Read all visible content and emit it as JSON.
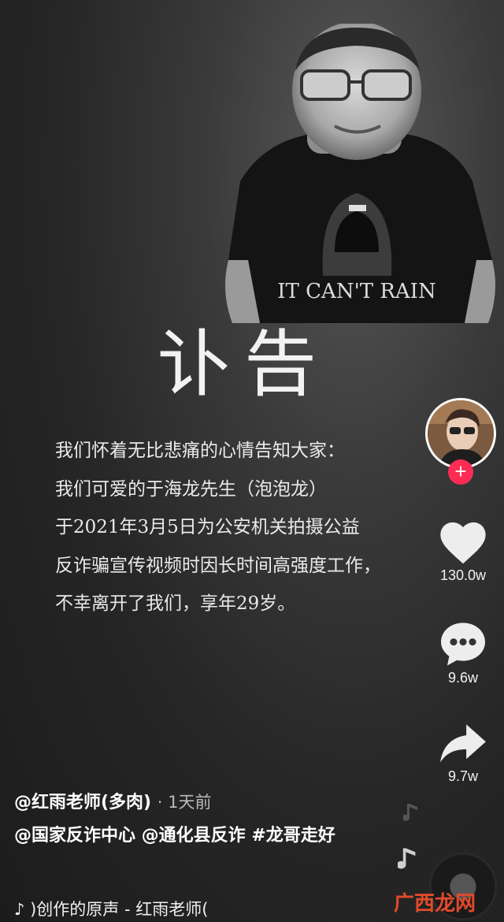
{
  "poster": {
    "shirt_text": "IT CAN'T RAIN",
    "title": "讣告",
    "lines": [
      "我们怀着无比悲痛的心情告知大家：",
      "我们可爱的于海龙先生（泡泡龙）",
      "于2021年3月5日为公安机关拍摄公益",
      "反诈骗宣传视频时因长时间高强度工作，",
      "不幸离开了我们，享年29岁。"
    ]
  },
  "actions": {
    "follow_symbol": "+",
    "likes": "130.0w",
    "comments": "9.6w",
    "shares": "9.7w"
  },
  "post": {
    "author": "@红雨老师(多肉)",
    "time": "· 1天前",
    "caption": "@国家反诈中心 @通化县反诈  #龙哥走好",
    "music": "♪  )创作的原声 - 红雨老师("
  },
  "watermark": "广西龙网",
  "colors": {
    "accent": "#fe2c55",
    "watermark": "#e24a2c"
  }
}
